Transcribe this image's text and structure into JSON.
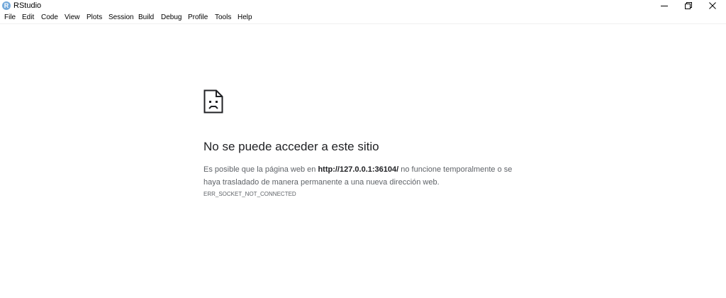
{
  "window": {
    "title": "RStudio",
    "icon_letter": "R",
    "icon": "rstudio-logo-icon",
    "controls": [
      "minimize-icon",
      "restore-icon",
      "close-icon"
    ]
  },
  "menu": {
    "items": [
      "File",
      "Edit",
      "Code",
      "View",
      "Plots",
      "Session",
      "Build",
      "Debug",
      "Profile",
      "Tools",
      "Help"
    ]
  },
  "error": {
    "icon": "sad-page-icon",
    "title": "No se puede acceder a este sitio",
    "desc_before": "Es posible que la página web en ",
    "url": "http://127.0.0.1:36104/",
    "desc_after": " no funcione temporalmente o se haya trasladado de manera permanente a una nueva dirección web.",
    "code": "ERR_SOCKET_NOT_CONNECTED"
  },
  "colors": {
    "accent": "#75aadb",
    "title_text": "#202124",
    "body_text": "#5f6368"
  }
}
